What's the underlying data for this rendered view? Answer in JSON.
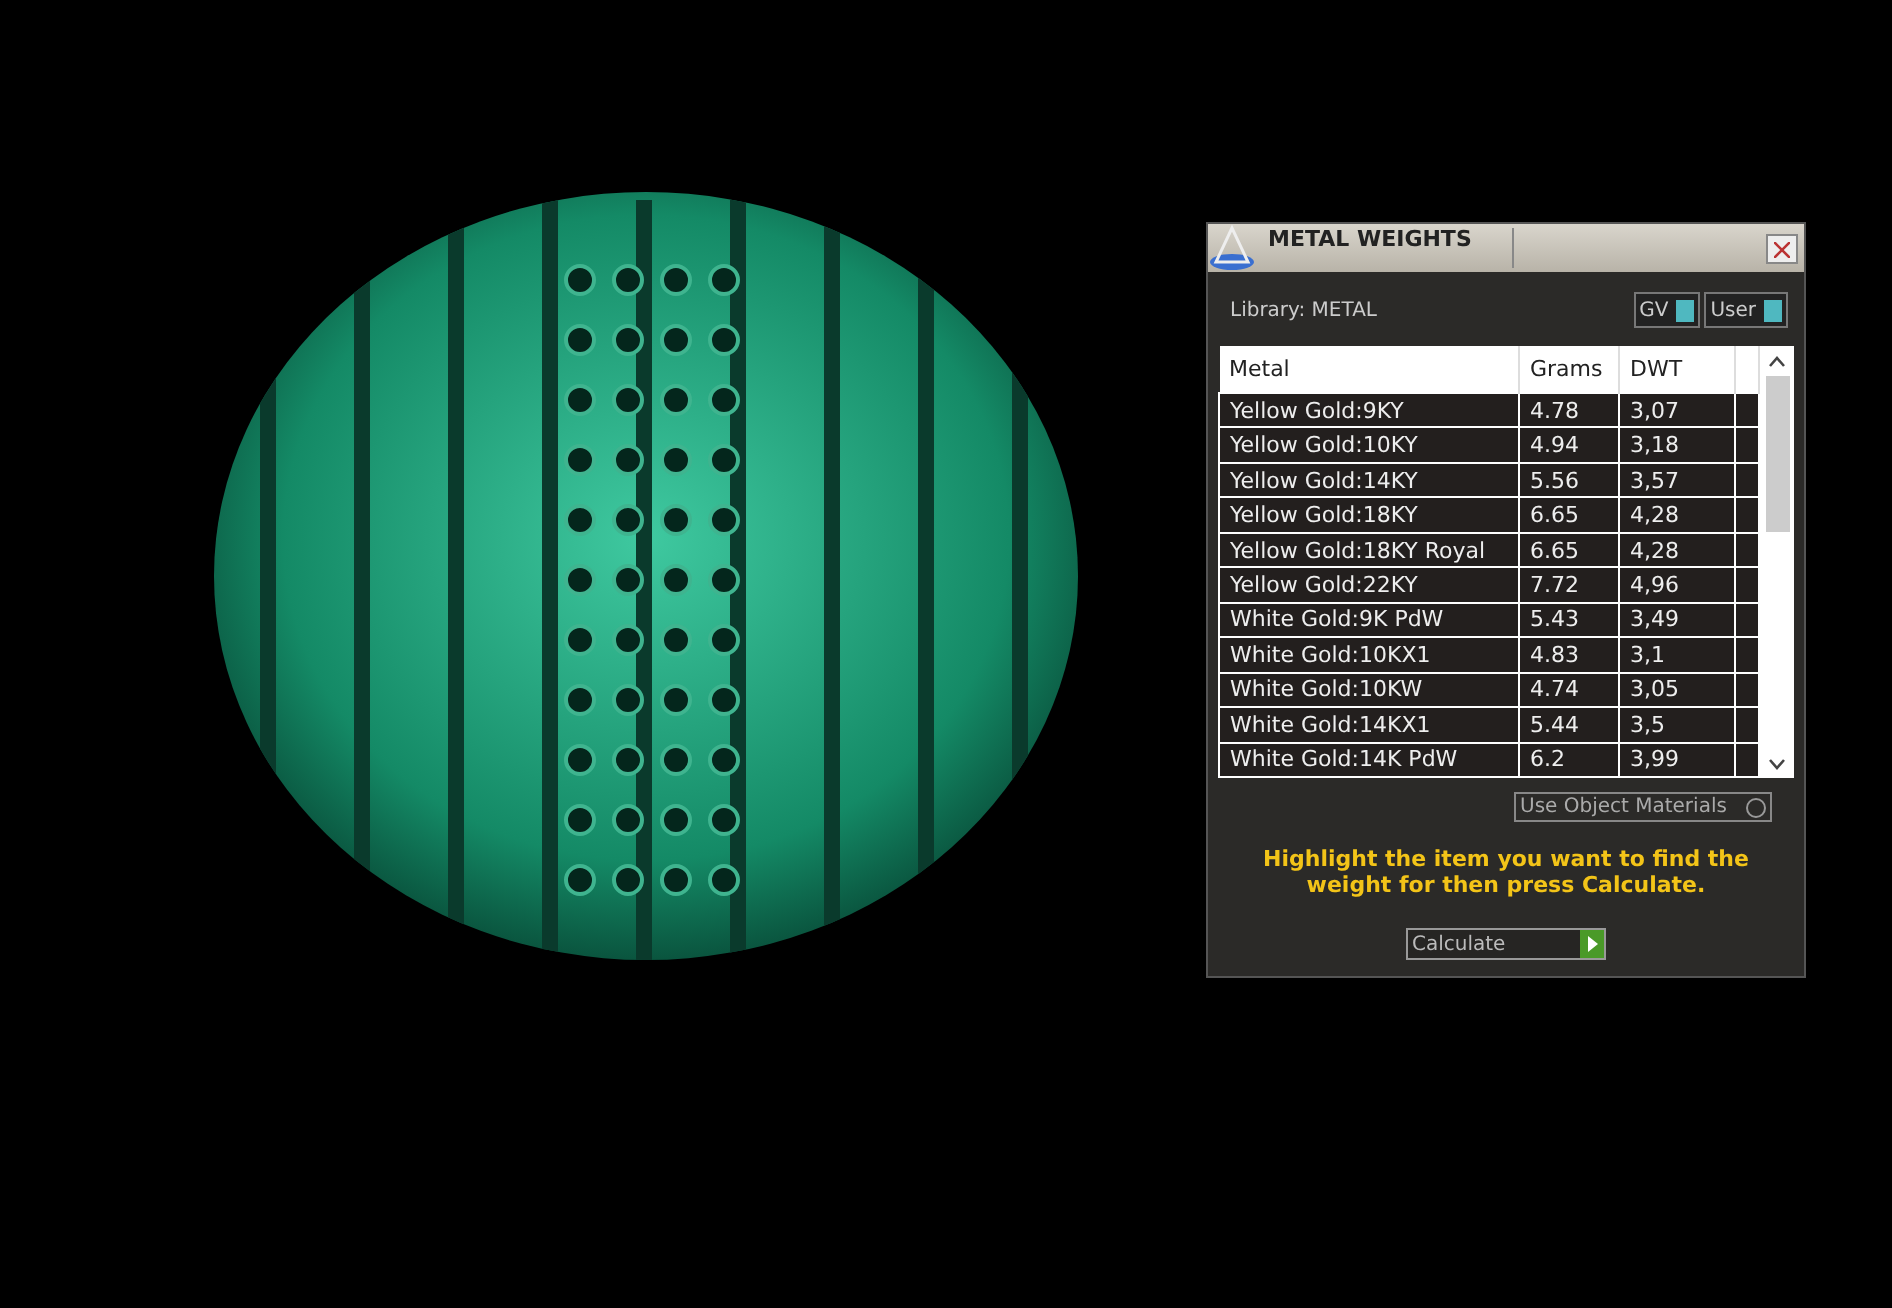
{
  "window": {
    "title": "METAL WEIGHTS"
  },
  "library": {
    "label": "Library: METAL"
  },
  "toggles": [
    {
      "label": "GV",
      "on": true
    },
    {
      "label": "User",
      "on": true
    }
  ],
  "table": {
    "columns": [
      "Metal",
      "Grams",
      "DWT"
    ],
    "rows": [
      {
        "cells": [
          "Yellow Gold:9KY",
          "4.78",
          "3,07"
        ]
      },
      {
        "cells": [
          "Yellow Gold:10KY",
          "4.94",
          "3,18"
        ]
      },
      {
        "cells": [
          "Yellow Gold:14KY",
          "5.56",
          "3,57"
        ]
      },
      {
        "cells": [
          "Yellow Gold:18KY",
          "6.65",
          "4,28"
        ]
      },
      {
        "cells": [
          "Yellow Gold:18KY Royal",
          "6.65",
          "4,28"
        ]
      },
      {
        "cells": [
          "Yellow Gold:22KY",
          "7.72",
          "4,96"
        ]
      },
      {
        "cells": [
          "White Gold:9K PdW",
          "5.43",
          "3,49"
        ]
      },
      {
        "cells": [
          "White Gold:10KX1",
          "4.83",
          "3,1"
        ]
      },
      {
        "cells": [
          "White Gold:10KW",
          "4.74",
          "3,05"
        ]
      },
      {
        "cells": [
          "White Gold:14KX1",
          "5.44",
          "3,5"
        ]
      },
      {
        "cells": [
          "White Gold:14K PdW",
          "6.2",
          "3,99"
        ]
      }
    ]
  },
  "use_object_materials": {
    "label": "Use Object Materials",
    "checked": false
  },
  "hint": "Highlight the item you want to find the weight for then press Calculate.",
  "calculate_button": {
    "label": "Calculate"
  }
}
